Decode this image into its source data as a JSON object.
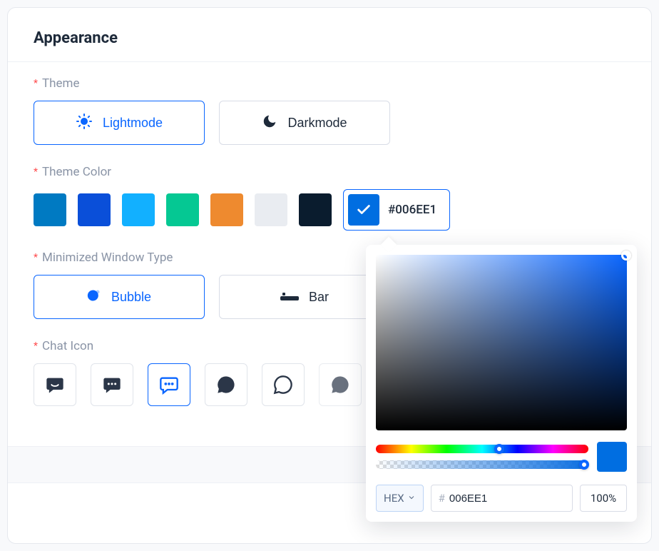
{
  "header": {
    "title": "Appearance"
  },
  "theme": {
    "label": "Theme",
    "options": [
      {
        "label": "Lightmode",
        "selected": true
      },
      {
        "label": "Darkmode",
        "selected": false
      }
    ]
  },
  "themeColor": {
    "label": "Theme Color",
    "swatches": [
      "#007AC2",
      "#0A4FD9",
      "#12B0FF",
      "#05C893",
      "#EE8A2F",
      "#E9ECF1",
      "#0A1C2E"
    ],
    "custom": {
      "hex": "#006EE1",
      "selected": true
    }
  },
  "minimized": {
    "label": "Minimized Window Type",
    "options": [
      {
        "label": "Bubble",
        "selected": true
      },
      {
        "label": "Bar",
        "selected": false
      }
    ]
  },
  "chatIcon": {
    "label": "Chat Icon",
    "selectedIndex": 2
  },
  "picker": {
    "hueBase": "#0a66ff",
    "huePct": 58,
    "alphaPct": 98,
    "preview": "#006EE1",
    "format": "HEX",
    "hexValue": "006EE1",
    "alphaText": "100%"
  }
}
